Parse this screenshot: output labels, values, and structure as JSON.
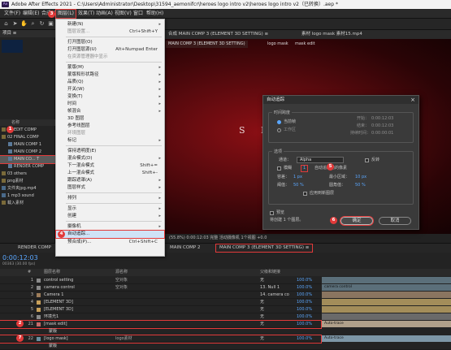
{
  "window": {
    "title": "Adobe After Effects 2021 - C:\\Users\\Administrator\\Desktop\\31594_aemonifcr\\heroes logo intro v2\\heroes logo intro v2（已转换）.aep *",
    "logo": "Ae"
  },
  "menubar": {
    "items": [
      "文件(F)",
      "编辑(E)",
      "合成(C)",
      "图层(L)",
      "效果(T)",
      "动画(A)",
      "视图(V)",
      "窗口",
      "帮助(H)"
    ],
    "active_index": 3
  },
  "project_panel": {
    "tab": "项目 ≡",
    "column_header": "名称",
    "items": [
      "01 EDIT COMP",
      "02 FINAL COMP",
      "MAIN COMP 1",
      "MAIN COMP 2",
      "MAIN CO... T",
      "RENDER COMP",
      "03 others",
      "png素材",
      "文件夹jpg.mp4",
      "1 mp3 sound",
      "载入素材"
    ],
    "selected_index": 4
  },
  "viewer": {
    "tabs": [
      "合成 MAIN COMP 3 (ELEMENT 3D SETTING) ≡",
      "素材 logo mask 素材15.mp4"
    ],
    "subtabs": [
      "MAIN COMP 3 (ELEMENT 3D SETTING)",
      "logo mask",
      "mask edit"
    ],
    "canvas_text": "S P",
    "footer": "(55.8%)   0:00:12:03   完整   活动摄像机   1个视图   +0.0"
  },
  "layer_menu": {
    "items": [
      {
        "label": "新建(N)",
        "shortcut": "",
        "arrow": true,
        "disabled": false
      },
      {
        "label": "图层设置...",
        "shortcut": "Ctrl+Shift+Y",
        "arrow": false,
        "disabled": true
      },
      {
        "sep": true
      },
      {
        "label": "打开图层(O)",
        "shortcut": "",
        "arrow": false,
        "disabled": false
      },
      {
        "label": "打开图层源(U)",
        "shortcut": "Alt+Numpad Enter",
        "arrow": false,
        "disabled": false
      },
      {
        "label": "在资源管理器中显示",
        "shortcut": "",
        "arrow": false,
        "disabled": true
      },
      {
        "sep": true
      },
      {
        "label": "蒙版(M)",
        "shortcut": "",
        "arrow": true,
        "disabled": false
      },
      {
        "label": "蒙版和形状路径",
        "shortcut": "",
        "arrow": true,
        "disabled": false
      },
      {
        "label": "品质(Q)",
        "shortcut": "",
        "arrow": true,
        "disabled": false
      },
      {
        "label": "开关(W)",
        "shortcut": "",
        "arrow": true,
        "disabled": false
      },
      {
        "label": "变换(T)",
        "shortcut": "",
        "arrow": true,
        "disabled": false
      },
      {
        "label": "时间",
        "shortcut": "",
        "arrow": true,
        "disabled": false
      },
      {
        "label": "帧混合",
        "shortcut": "",
        "arrow": true,
        "disabled": false
      },
      {
        "label": "3D 图层",
        "shortcut": "",
        "arrow": false,
        "disabled": false
      },
      {
        "label": "参考线图层",
        "shortcut": "",
        "arrow": false,
        "disabled": false
      },
      {
        "label": "环境图层",
        "shortcut": "",
        "arrow": false,
        "disabled": true
      },
      {
        "label": "标记",
        "shortcut": "",
        "arrow": true,
        "disabled": false
      },
      {
        "sep": true
      },
      {
        "label": "保持透明度(E)",
        "shortcut": "",
        "arrow": false,
        "disabled": false
      },
      {
        "label": "混合模式(D)",
        "shortcut": "",
        "arrow": true,
        "disabled": false
      },
      {
        "label": "下一混合模式",
        "shortcut": "Shift+=",
        "arrow": false,
        "disabled": false
      },
      {
        "label": "上一混合模式",
        "shortcut": "Shift+-",
        "arrow": false,
        "disabled": false
      },
      {
        "label": "跟踪遮罩(A)",
        "shortcut": "",
        "arrow": true,
        "disabled": false
      },
      {
        "label": "图层样式",
        "shortcut": "",
        "arrow": true,
        "disabled": false
      },
      {
        "sep": true
      },
      {
        "label": "排列",
        "shortcut": "",
        "arrow": true,
        "disabled": false
      },
      {
        "sep": true
      },
      {
        "label": "显示",
        "shortcut": "",
        "arrow": true,
        "disabled": false
      },
      {
        "label": "创建",
        "shortcut": "",
        "arrow": true,
        "disabled": false
      },
      {
        "sep": true
      },
      {
        "label": "摄像机",
        "shortcut": "",
        "arrow": true,
        "disabled": false
      },
      {
        "label": "自动追踪...",
        "shortcut": "",
        "arrow": false,
        "disabled": false,
        "highlight": true
      },
      {
        "label": "预合成(P)...",
        "shortcut": "Ctrl+Shift+C",
        "arrow": false,
        "disabled": false
      }
    ]
  },
  "auto_trace_dialog": {
    "title": "自动追踪",
    "close": "×",
    "time_span_legend": "时间跨度",
    "time_options": [
      "当前帧",
      "工作区"
    ],
    "start_label": "开始：",
    "start_value": "0:00:12:03",
    "end_label": "结束：",
    "end_value": "0:00:12:03",
    "duration_label": "持续时间：",
    "duration_value": "0:00:00:01",
    "options_legend": "选项",
    "channel_label": "通道：",
    "channel_value": "Alpha",
    "invert_label": "反转",
    "blur_label": "模糊",
    "blur_value": "1",
    "blur_suffix": "自动追踪前的像素",
    "tolerance_label": "容差：",
    "tolerance_value": "1 px",
    "min_area_label": "最小区域：",
    "min_area_value": "10 px",
    "threshold_label": "阈值：",
    "threshold_value": "50 %",
    "corner_label": "圆角值：",
    "corner_value": "50 %",
    "apply_new_layer_label": "应用到新图层",
    "preview_label": "预览",
    "footer_note": "将创建 1 个图层。",
    "ok": "确定",
    "cancel": "取消"
  },
  "timeline": {
    "tabs": [
      "RENDER COMP",
      "MAIN COMP 2",
      "MAIN COMP 3 (ELEMENT 3D SETTING) ≡"
    ],
    "timecode": "0:00:12:03",
    "timecode_sub": "00363 (30.00 fps)",
    "columns": [
      "#",
      "图层名称",
      "源名称",
      "父级和链接"
    ],
    "layers": [
      {
        "index": "1",
        "name": "control setting",
        "source": "空对象",
        "parent": "无",
        "pct": "100.0%",
        "color": "#8a8a8a"
      },
      {
        "index": "2",
        "name": "camera control",
        "source": "空对象",
        "parent": "13. Null 1",
        "pct": "100.0%",
        "color": "#8a8a8a"
      },
      {
        "index": "3",
        "name": "Camera 1",
        "source": "",
        "parent": "14. camera co",
        "pct": "100.0%",
        "color": "#9e7d5a"
      },
      {
        "index": "4",
        "name": "[ELEMENT 3D]",
        "source": "",
        "parent": "无",
        "pct": "100.0%",
        "color": "#c8a05a"
      },
      {
        "index": "5",
        "name": "[ELEMENT 3D]",
        "source": "",
        "parent": "无",
        "pct": "100.0%",
        "color": "#c8a05a"
      },
      {
        "index": "6",
        "name": "环境光1",
        "source": "",
        "parent": "无",
        "pct": "100.0%",
        "color": "#8a8a8a"
      },
      {
        "index": "21",
        "name": "[mask edit]",
        "source": "",
        "parent": "无",
        "pct": "100.0%",
        "color": "#c46a6a"
      },
      {
        "index": "",
        "name": "蒙版",
        "source": "",
        "parent": "",
        "pct": "",
        "color": "#232323"
      },
      {
        "index": "22",
        "name": "[logo mask]",
        "source": "logo素材",
        "parent": "无",
        "pct": "100.0%",
        "color": "#6a8fa0"
      },
      {
        "index": "",
        "name": "蒙版",
        "source": "",
        "parent": "",
        "pct": "",
        "color": "#232323"
      }
    ],
    "bar_labels": [
      "camera control",
      "Auto-trace",
      "Auto-trace"
    ]
  },
  "annotations": [
    "1",
    "2",
    "3",
    "4",
    "5",
    "6",
    "7"
  ],
  "colors": {
    "accent_red": "#e23a3a",
    "timecode_blue": "#5aa7ff",
    "menu_bg": "#f1f1f1"
  }
}
